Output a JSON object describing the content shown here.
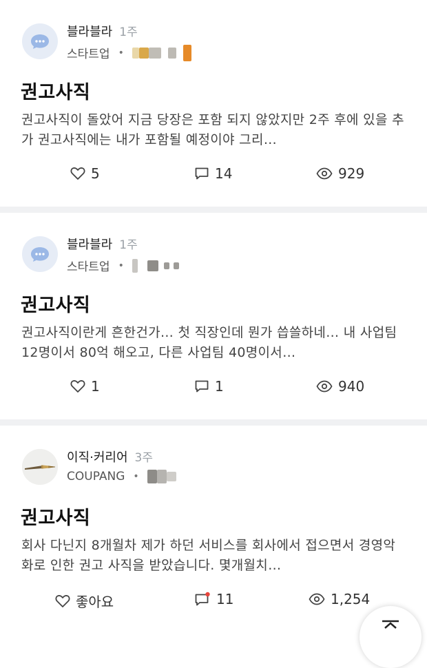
{
  "posts": [
    {
      "community": "블라블라",
      "ago": "1주",
      "company": "스타트업",
      "title": "권고사직",
      "body": "권고사직이 돌았어 지금 당장은 포함 되지 않았지만 2주 후에 있을 추가 권고사직에는 내가 포함될 예정이야 그리…",
      "likes": "5",
      "comments": "14",
      "views": "929",
      "avatar": "chat-bubble-icon"
    },
    {
      "community": "블라블라",
      "ago": "1주",
      "company": "스타트업",
      "title": "권고사직",
      "body": "권고사직이란게 흔한건가… 첫 직장인데 뭔가 씁쓸하네… 내 사업팀 12명이서 80억 해오고, 다른 사업팀 40명이서…",
      "likes": "1",
      "comments": "1",
      "views": "940",
      "avatar": "chat-bubble-icon"
    },
    {
      "community": "이직·커리어",
      "ago": "3주",
      "company": "COUPANG",
      "title": "권고사직",
      "body": "회사 다닌지 8개월차 제가 하던 서비스를 회사에서 접으면서 경영악화로 인한 권고 사직을 받았습니다.  몇개월치…",
      "likes": "좋아요",
      "comments": "11",
      "views": "1,254",
      "avatar": "fountain-pen-icon"
    }
  ],
  "colors": {
    "avatar_bg": "#e6ecf6",
    "avatar_bubble": "#9bb8e6",
    "divider": "#f0f1f3",
    "comment_badge": "#e8453c"
  }
}
